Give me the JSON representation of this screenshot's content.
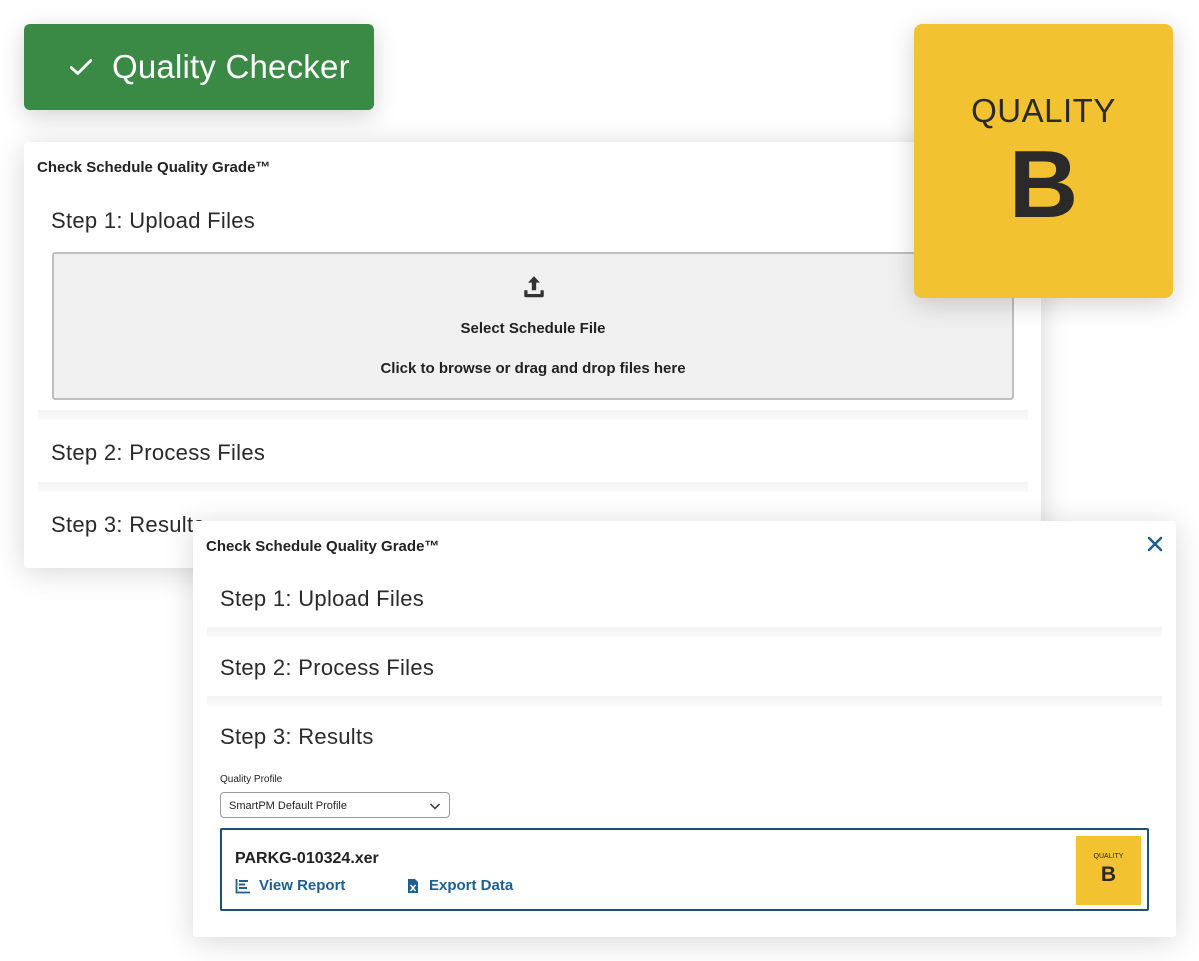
{
  "badge": {
    "title": "Quality Checker"
  },
  "quality_badge_large": {
    "label": "QUALITY",
    "grade": "B"
  },
  "panel_back": {
    "title": "Check Schedule Quality Grade™",
    "step1": "Step 1: Upload Files",
    "dropzone": {
      "title": "Select Schedule File",
      "hint": "Click to browse or drag and drop files here"
    },
    "step2": "Step 2: Process Files",
    "step3": "Step 3: Results"
  },
  "panel_front": {
    "title": "Check Schedule Quality Grade™",
    "step1": "Step 1: Upload Files",
    "step2": "Step 2: Process Files",
    "step3": "Step 3: Results",
    "profile": {
      "label": "Quality Profile",
      "selected": "SmartPM Default Profile"
    },
    "result": {
      "filename": "PARKG-010324.xer",
      "view_report": "View Report",
      "export_data": "Export Data",
      "quality_label": "QUALITY",
      "grade": "B"
    }
  },
  "colors": {
    "badge_green": "#3a8a45",
    "quality_yellow": "#f2c231",
    "link_blue": "#1e5f8f",
    "card_border": "#1f4f73"
  },
  "icons": [
    "check-icon",
    "upload-icon",
    "close-icon",
    "chevron-down-icon",
    "chart-icon",
    "file-excel-icon"
  ]
}
